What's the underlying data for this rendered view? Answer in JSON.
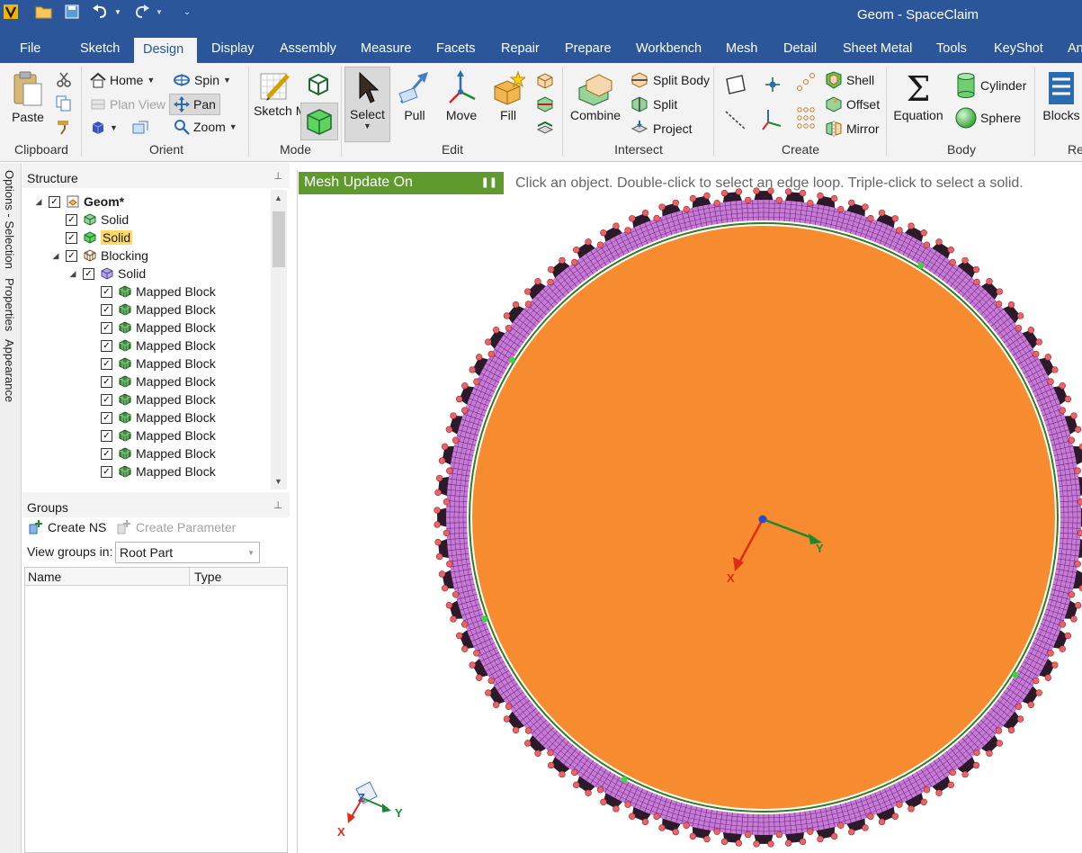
{
  "window": {
    "title": "Geom - SpaceClaim"
  },
  "tabs": [
    "File",
    "Sketch",
    "Design",
    "Display",
    "Assembly",
    "Measure",
    "Facets",
    "Repair",
    "Prepare",
    "Workbench",
    "Mesh",
    "Detail",
    "Sheet Metal",
    "Tools",
    "KeyShot",
    "An"
  ],
  "active_tab": "Design",
  "ribbon": {
    "clipboard": {
      "paste": "Paste",
      "label": "Clipboard"
    },
    "orient": {
      "home": "Home",
      "spin": "Spin",
      "plan_view": "Plan View",
      "pan": "Pan",
      "zoom": "Zoom",
      "label": "Orient"
    },
    "mode": {
      "sketch_mode": "Sketch Mode",
      "label": "Mode"
    },
    "edit": {
      "select": "Select",
      "pull": "Pull",
      "move": "Move",
      "fill": "Fill",
      "label": "Edit"
    },
    "intersect": {
      "combine": "Combine",
      "split_body": "Split Body",
      "split": "Split",
      "project": "Project",
      "label": "Intersect"
    },
    "create": {
      "shell": "Shell",
      "offset": "Offset",
      "mirror": "Mirror",
      "label": "Create"
    },
    "body": {
      "equation": "Equation",
      "cylinder": "Cylinder",
      "sphere": "Sphere",
      "label": "Body"
    },
    "re": {
      "blocks": "Blocks",
      "label": "Re"
    }
  },
  "side_tabs": [
    "Options - Selection",
    "Properties",
    "Appearance"
  ],
  "structure": {
    "title": "Structure",
    "items": [
      {
        "label": "Geom*",
        "bold": true
      },
      {
        "label": "Solid"
      },
      {
        "label": "Solid",
        "selected": true
      },
      {
        "label": "Blocking"
      },
      {
        "label": "Solid"
      },
      {
        "label": "Mapped Block"
      },
      {
        "label": "Mapped Block"
      },
      {
        "label": "Mapped Block"
      },
      {
        "label": "Mapped Block"
      },
      {
        "label": "Mapped Block"
      },
      {
        "label": "Mapped Block"
      },
      {
        "label": "Mapped Block"
      },
      {
        "label": "Mapped Block"
      },
      {
        "label": "Mapped Block"
      },
      {
        "label": "Mapped Block"
      },
      {
        "label": "Mapped Block"
      }
    ]
  },
  "groups": {
    "title": "Groups",
    "create_ns": "Create NS",
    "create_parameter": "Create Parameter",
    "view_groups_label": "View groups in:",
    "view_groups_value": "Root Part",
    "columns": [
      "Name",
      "Type"
    ]
  },
  "viewport": {
    "mesh_badge": "Mesh Update On",
    "hint": "Click an object. Double-click to select an edge loop. Triple-click to select a solid.",
    "triad": {
      "x": "X",
      "y": "Y"
    },
    "corner_triad": {
      "x": "X",
      "y": "Y",
      "z": "Z"
    },
    "colors": {
      "face": "#f68b2f",
      "mesh": "#c77ad6",
      "vertex": "#e8646a",
      "edge": "#2f7d1e"
    }
  }
}
